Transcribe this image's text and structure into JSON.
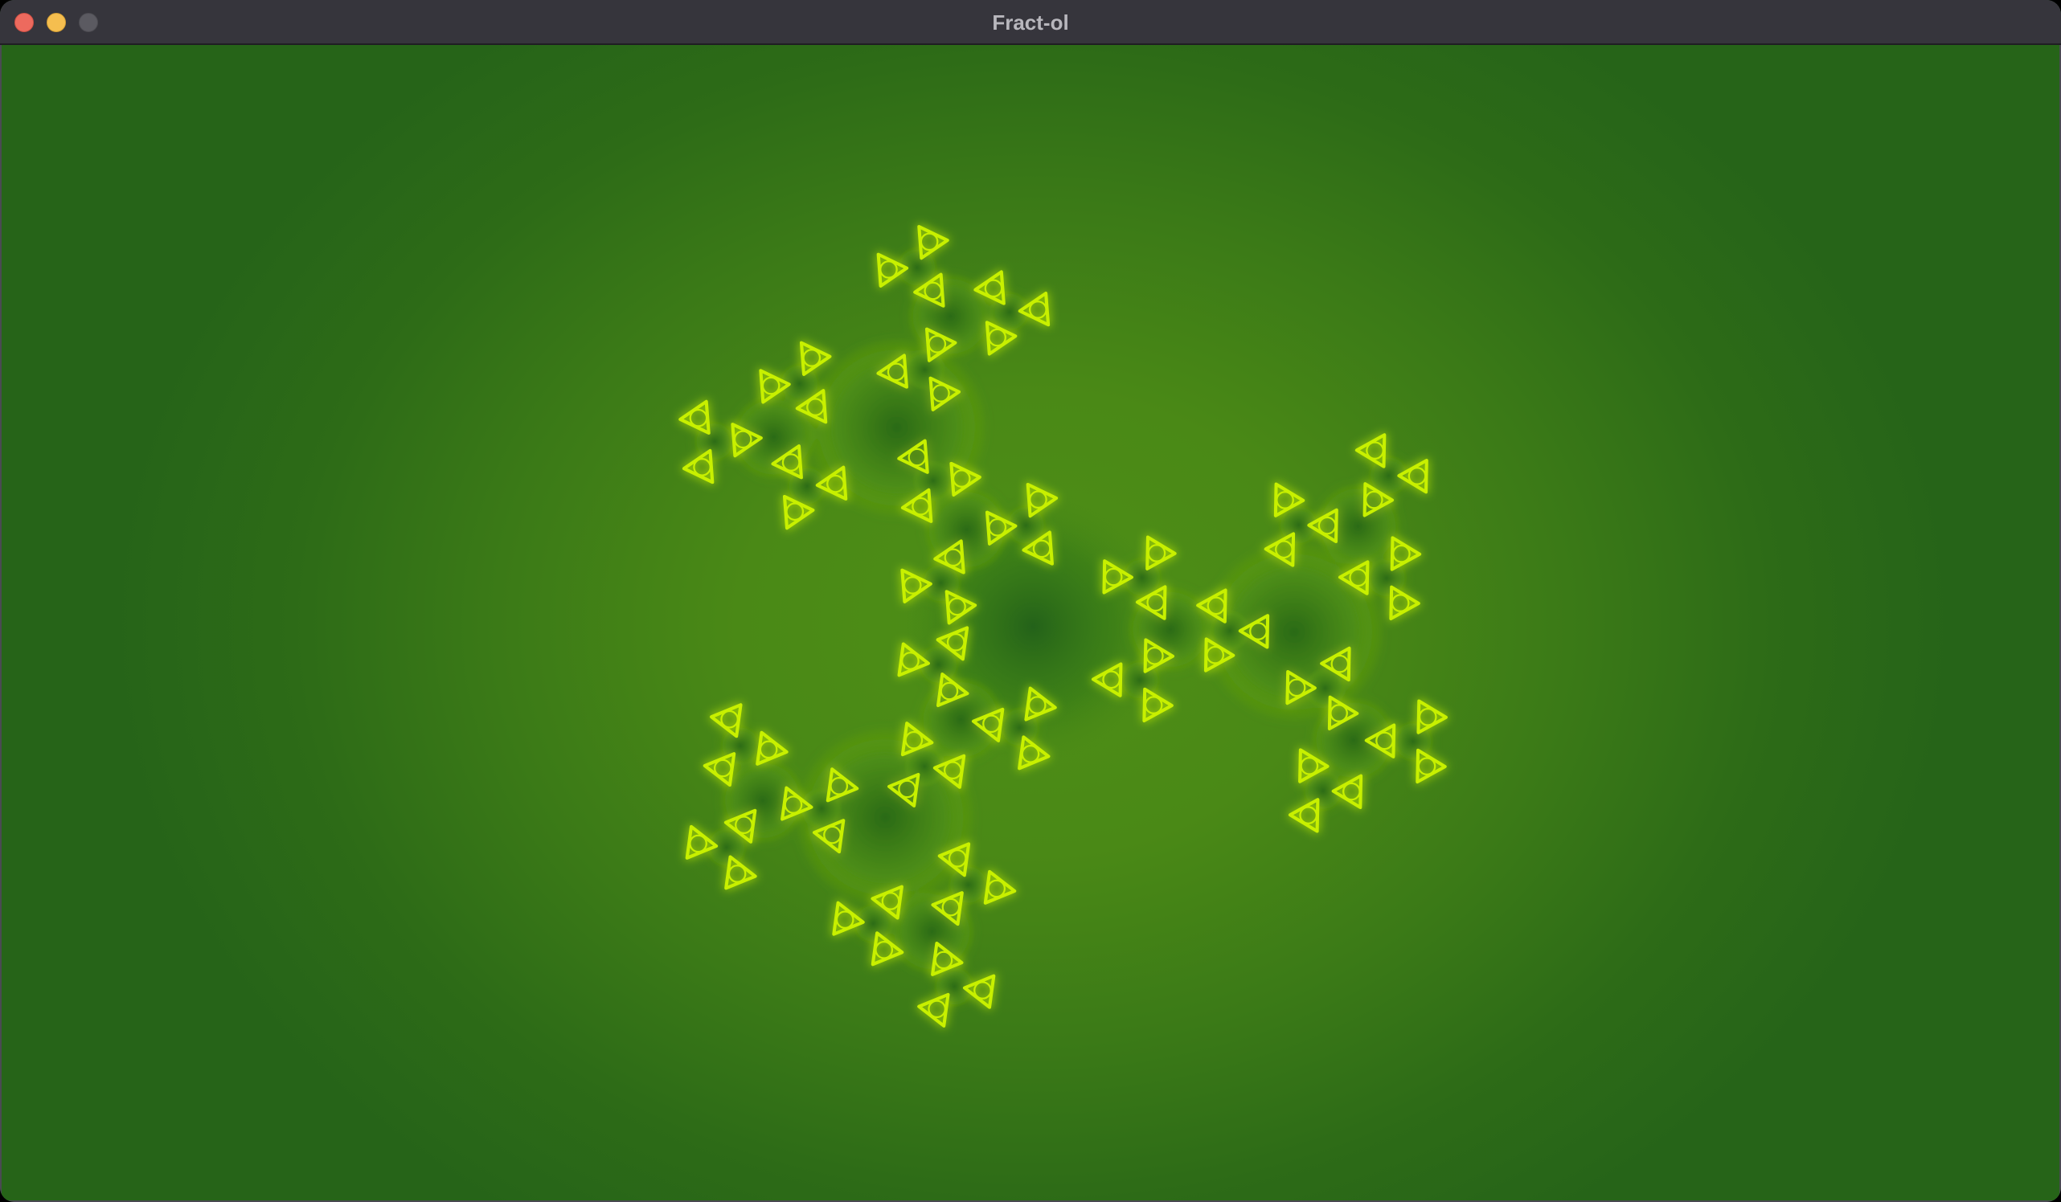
{
  "window": {
    "title": "Fract-ol"
  },
  "titlebar": {
    "buttons": [
      "close",
      "minimize",
      "zoom"
    ]
  },
  "fractal": {
    "description_icon": "fractal-render",
    "colors": {
      "background": "#266418",
      "glow": "#4e8f17",
      "filament": "#c8f000",
      "core": "#1d5a1a"
    }
  }
}
